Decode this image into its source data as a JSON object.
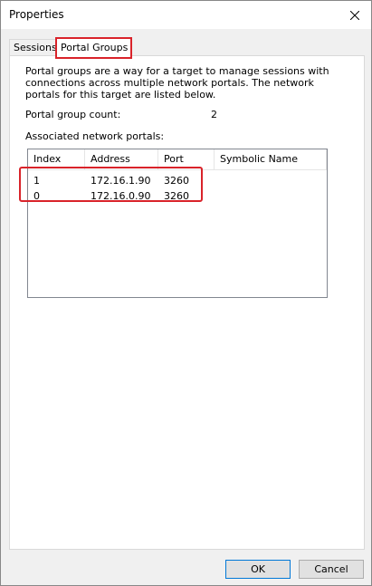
{
  "window": {
    "title": "Properties"
  },
  "tabs": [
    {
      "label": "Sessions"
    },
    {
      "label": "Portal Groups"
    }
  ],
  "panel": {
    "description": "Portal groups are a way for a target to manage sessions with connections across multiple network portals.  The network portals for this target are listed below.",
    "count_label": "Portal group count:",
    "count_value": "2",
    "associated_label": "Associated network portals:"
  },
  "table": {
    "columns": [
      "Index",
      "Address",
      "Port",
      "Symbolic Name"
    ],
    "rows": [
      {
        "index": "1",
        "address": "172.16.1.90",
        "port": "3260",
        "symbolic": ""
      },
      {
        "index": "0",
        "address": "172.16.0.90",
        "port": "3260",
        "symbolic": ""
      }
    ]
  },
  "buttons": {
    "ok": "OK",
    "cancel": "Cancel"
  },
  "colors": {
    "highlight": "#d9232a",
    "accent": "#0078d7"
  },
  "icons": {
    "close": "close-icon"
  }
}
